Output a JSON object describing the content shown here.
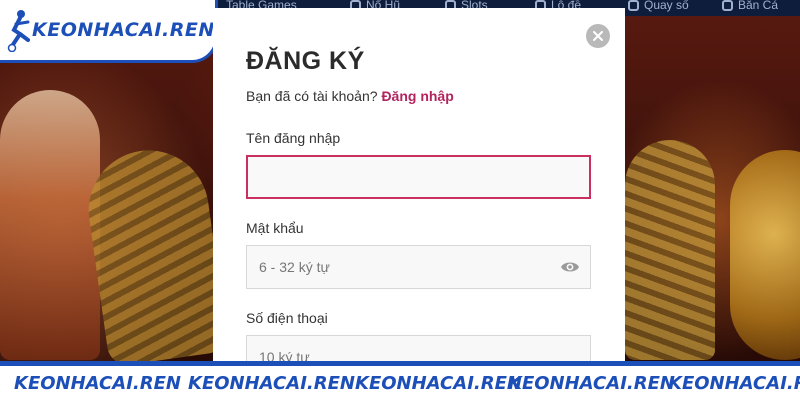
{
  "nav": {
    "items": [
      {
        "label": "Table Games",
        "icon": "table-icon"
      },
      {
        "label": "Nổ Hũ",
        "icon": "jackpot-icon"
      },
      {
        "label": "Slots",
        "icon": "slots-icon"
      },
      {
        "label": "Lô đề",
        "icon": "lottery-icon"
      },
      {
        "label": "Quay số",
        "icon": "spin-icon"
      },
      {
        "label": "Bắn Cá",
        "icon": "fish-icon"
      }
    ]
  },
  "logo": {
    "text": "KEONHACAI.REN",
    "brand_color": "#1d4fb8"
  },
  "modal": {
    "title": "ĐĂNG KÝ",
    "subtitle": "Bạn đã có tài khoản?",
    "login_link": "Đăng nhập",
    "fields": [
      {
        "label": "Tên đăng nhập",
        "value": "",
        "placeholder": ""
      },
      {
        "label": "Mật khẩu",
        "value": "",
        "placeholder": "6 - 32 ký tự"
      },
      {
        "label": "Số điện thoại",
        "value": "",
        "placeholder": "10 ký tự"
      }
    ],
    "accent_color": "#c9305f"
  },
  "banner": {
    "items": [
      "KEONHACAI.REN",
      "KEONHACAI.REN",
      "KEONHACAI.REN",
      "KEONHACAI.REN",
      "KEONHACAI.REN"
    ]
  }
}
